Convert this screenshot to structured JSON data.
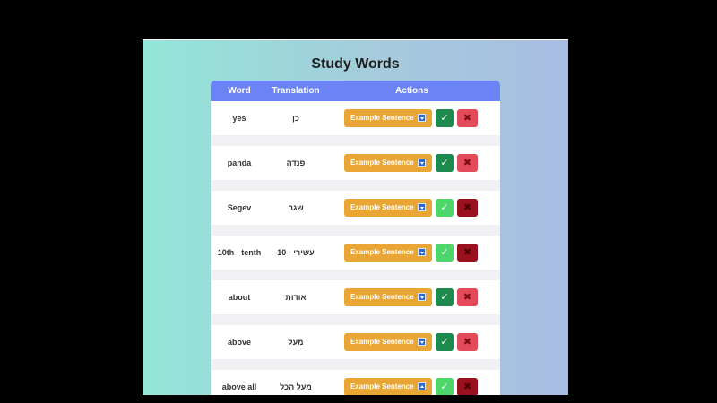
{
  "page": {
    "title": "Study Words"
  },
  "table": {
    "headers": {
      "word": "Word",
      "translation": "Translation",
      "actions": "Actions"
    },
    "example_label": "Example Sentence",
    "check_glyph": "✓",
    "x_glyph": "✖",
    "rows": [
      {
        "word": "yes",
        "translation": "כן",
        "dropdown_icon": "chevron-down-icon",
        "check_style": "dark",
        "x_style": "light"
      },
      {
        "word": "panda",
        "translation": "פנדה",
        "dropdown_icon": "chevron-down-icon",
        "check_style": "dark",
        "x_style": "light"
      },
      {
        "word": "Segev",
        "translation": "שגב",
        "dropdown_icon": "chevron-down-icon",
        "check_style": "light",
        "x_style": "dark"
      },
      {
        "word": "10th - tenth",
        "translation": "עשירי - 10",
        "dropdown_icon": "chevron-down-icon",
        "check_style": "light",
        "x_style": "dark"
      },
      {
        "word": "about",
        "translation": "אודות",
        "dropdown_icon": "chevron-down-icon",
        "check_style": "dark",
        "x_style": "light"
      },
      {
        "word": "above",
        "translation": "מעל",
        "dropdown_icon": "chevron-down-icon",
        "check_style": "dark",
        "x_style": "light"
      },
      {
        "word": "above all",
        "translation": "מעל הכל",
        "dropdown_icon": "chevron-up-icon",
        "check_style": "light",
        "x_style": "dark"
      }
    ]
  },
  "colors": {
    "header_bg": "#6b83f5",
    "example_button": "#e9a634",
    "check_dark": "#1f8a4f",
    "check_light": "#4fd66b",
    "x_light": "#e34b5a",
    "x_dark": "#99101e"
  }
}
